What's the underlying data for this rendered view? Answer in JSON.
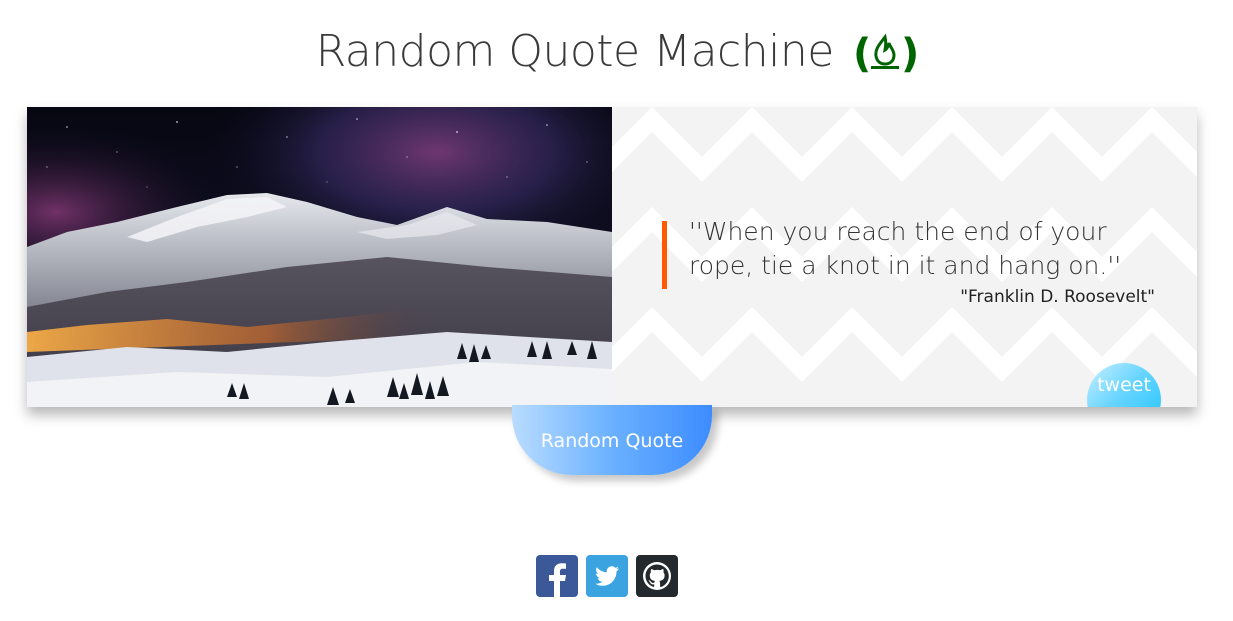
{
  "header": {
    "title": "Random Quote Machine",
    "brand_color": "#006400",
    "brand_icon": "fire-icon"
  },
  "quote": {
    "text": "''When you reach the end of your rope, tie a knot in it and hang on.''",
    "author": "\"Franklin D. Roosevelt\"",
    "accent_color": "#ff5a00"
  },
  "buttons": {
    "tweet_label": "tweet",
    "random_label": "Random Quote"
  },
  "social": {
    "items": [
      {
        "name": "facebook",
        "icon": "facebook-icon",
        "color": "#3b5998"
      },
      {
        "name": "twitter",
        "icon": "twitter-icon",
        "color": "#3aa3e0"
      },
      {
        "name": "github",
        "icon": "github-icon",
        "color": "#24292e"
      }
    ]
  }
}
